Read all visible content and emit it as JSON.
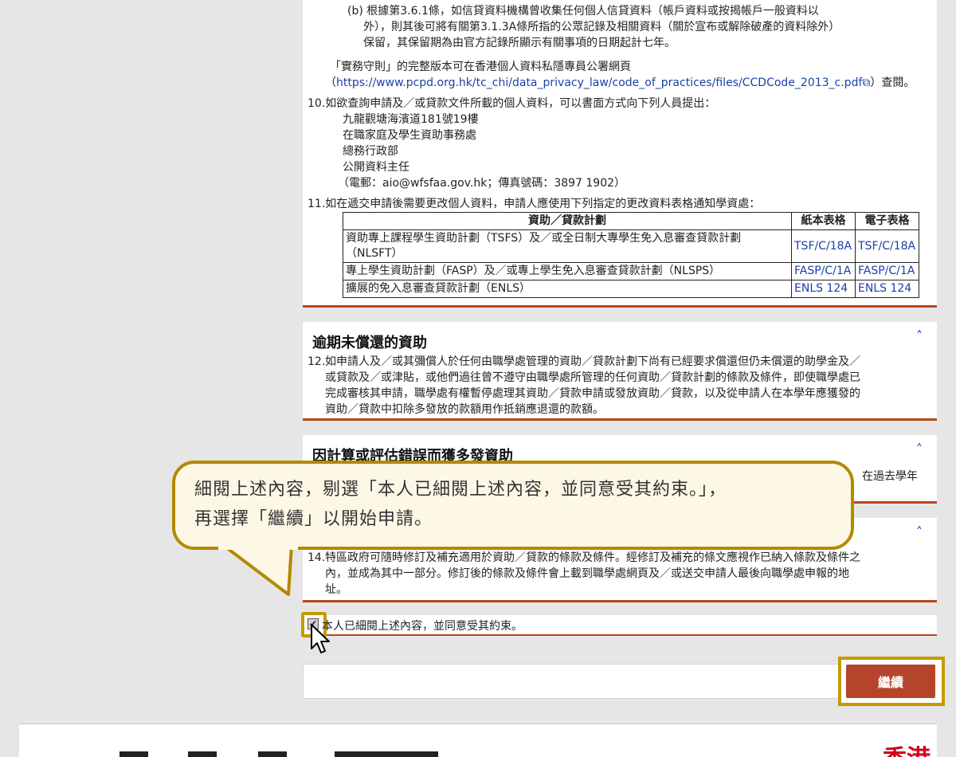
{
  "top_section": {
    "item_b_line1": "(b) 根據第3.6.1條，如信貸資料機構曾收集任何個人信貸資料（帳戶資料或按揭帳戶一般資料以",
    "item_b_line2": "外），則其後可將有關第3.1.3A條所指的公眾記錄及相關資料（關於宣布或解除破產的資料除外）",
    "item_b_line3": "保留，其保留期為由官方記錄所顯示有關事項的日期起計七年。",
    "code_line1": "「實務守則」的完整版本可在香港個人資料私隱專員公署網頁",
    "code_url": "https://www.pcpd.org.hk/tc_chi/data_privacy_law/code_of_practices/files/CCDCode_2013_c.pdf",
    "code_suffix": "）查閱。",
    "item10": "10.如欲查詢申請及／或貸款文件所載的個人資料，可以書面方式向下列人員提出：",
    "addr1": "九龍觀塘海濱道181號19樓",
    "addr2": "在職家庭及學生資助事務處",
    "addr3": "總務行政部",
    "addr4": "公開資料主任",
    "addr5": "（電郵：aio@wfsfaa.gov.hk；傳真號碼：3897 1902）",
    "item11": "11.如在遞交申請後需要更改個人資料，申請人應使用下列指定的更改資料表格通知學資處："
  },
  "table": {
    "headers": [
      "資助／貸款計劃",
      "紙本表格",
      "電子表格"
    ],
    "rows": [
      {
        "scheme": "資助專上課程學生資助計劃（TSFS）及／或全日制大專學生免入息審查貸款計劃（NLSFT）",
        "paper": "TSF/C/18A",
        "electronic": "TSF/C/18A"
      },
      {
        "scheme": "專上學生資助計劃（FASP）及／或專上學生免入息審查貸款計劃（NLSPS）",
        "paper": "FASP/C/1A",
        "electronic": "FASP/C/1A"
      },
      {
        "scheme": "擴展的免入息審查貸款計劃（ENLS）",
        "paper": "ENLS 124",
        "electronic": "ENLS 124"
      }
    ]
  },
  "sec_overdue": {
    "title": "逾期未償還的資助",
    "chevron": "˄",
    "num": "12.",
    "line1": "如申請人及／或其彌償人於任何由職學處管理的資助／貸款計劃下尚有已經要求償還但仍未償還的助學金及／",
    "line2": "或貸款及／或津貼，或他們過往曾不遵守由職學處所管理的任何資助／貸款計劃的條款及條件，即使職學處已",
    "line3": "完成審核其申請，職學處有權暫停處理其資助／貸款申請或發放資助／貸款，以及從申請人在本學年應獲發的",
    "line4": "資助／貸款中扣除多發放的款額用作抵銷應退還的款額。"
  },
  "sec_overpay": {
    "title": "因計算或評估錯誤而獲多發資助",
    "chevron": "˄",
    "partial": "在過去學年"
  },
  "sec_amend": {
    "chevron": "˄",
    "num": "14.",
    "line1": "特區政府可隨時修訂及補充適用於資助／貸款的條款及條件。經修訂及補充的條文應視作已納入條款及條件之",
    "line2": "內，並成為其中一部分。修訂後的條款及條件會上載到職學處網頁及／或送交申請人最後向職學處申報的地",
    "line3": "址。"
  },
  "agree": {
    "label": "本人已細閱上述內容，並同意受其約束。",
    "checked_mark": "✔"
  },
  "continue_button": "繼續",
  "tooltip": {
    "line1": "細閱上述內容，剔選「本人已細閱上述內容，並同意受其約束。」，",
    "line2": "再選擇「繼續」以開始申請。"
  },
  "footer": {
    "logo_text": "香港"
  },
  "colors": {
    "accent": "#b8451c",
    "button": "#b5452a",
    "highlight": "#c49a00",
    "link": "#1a3fa8"
  }
}
